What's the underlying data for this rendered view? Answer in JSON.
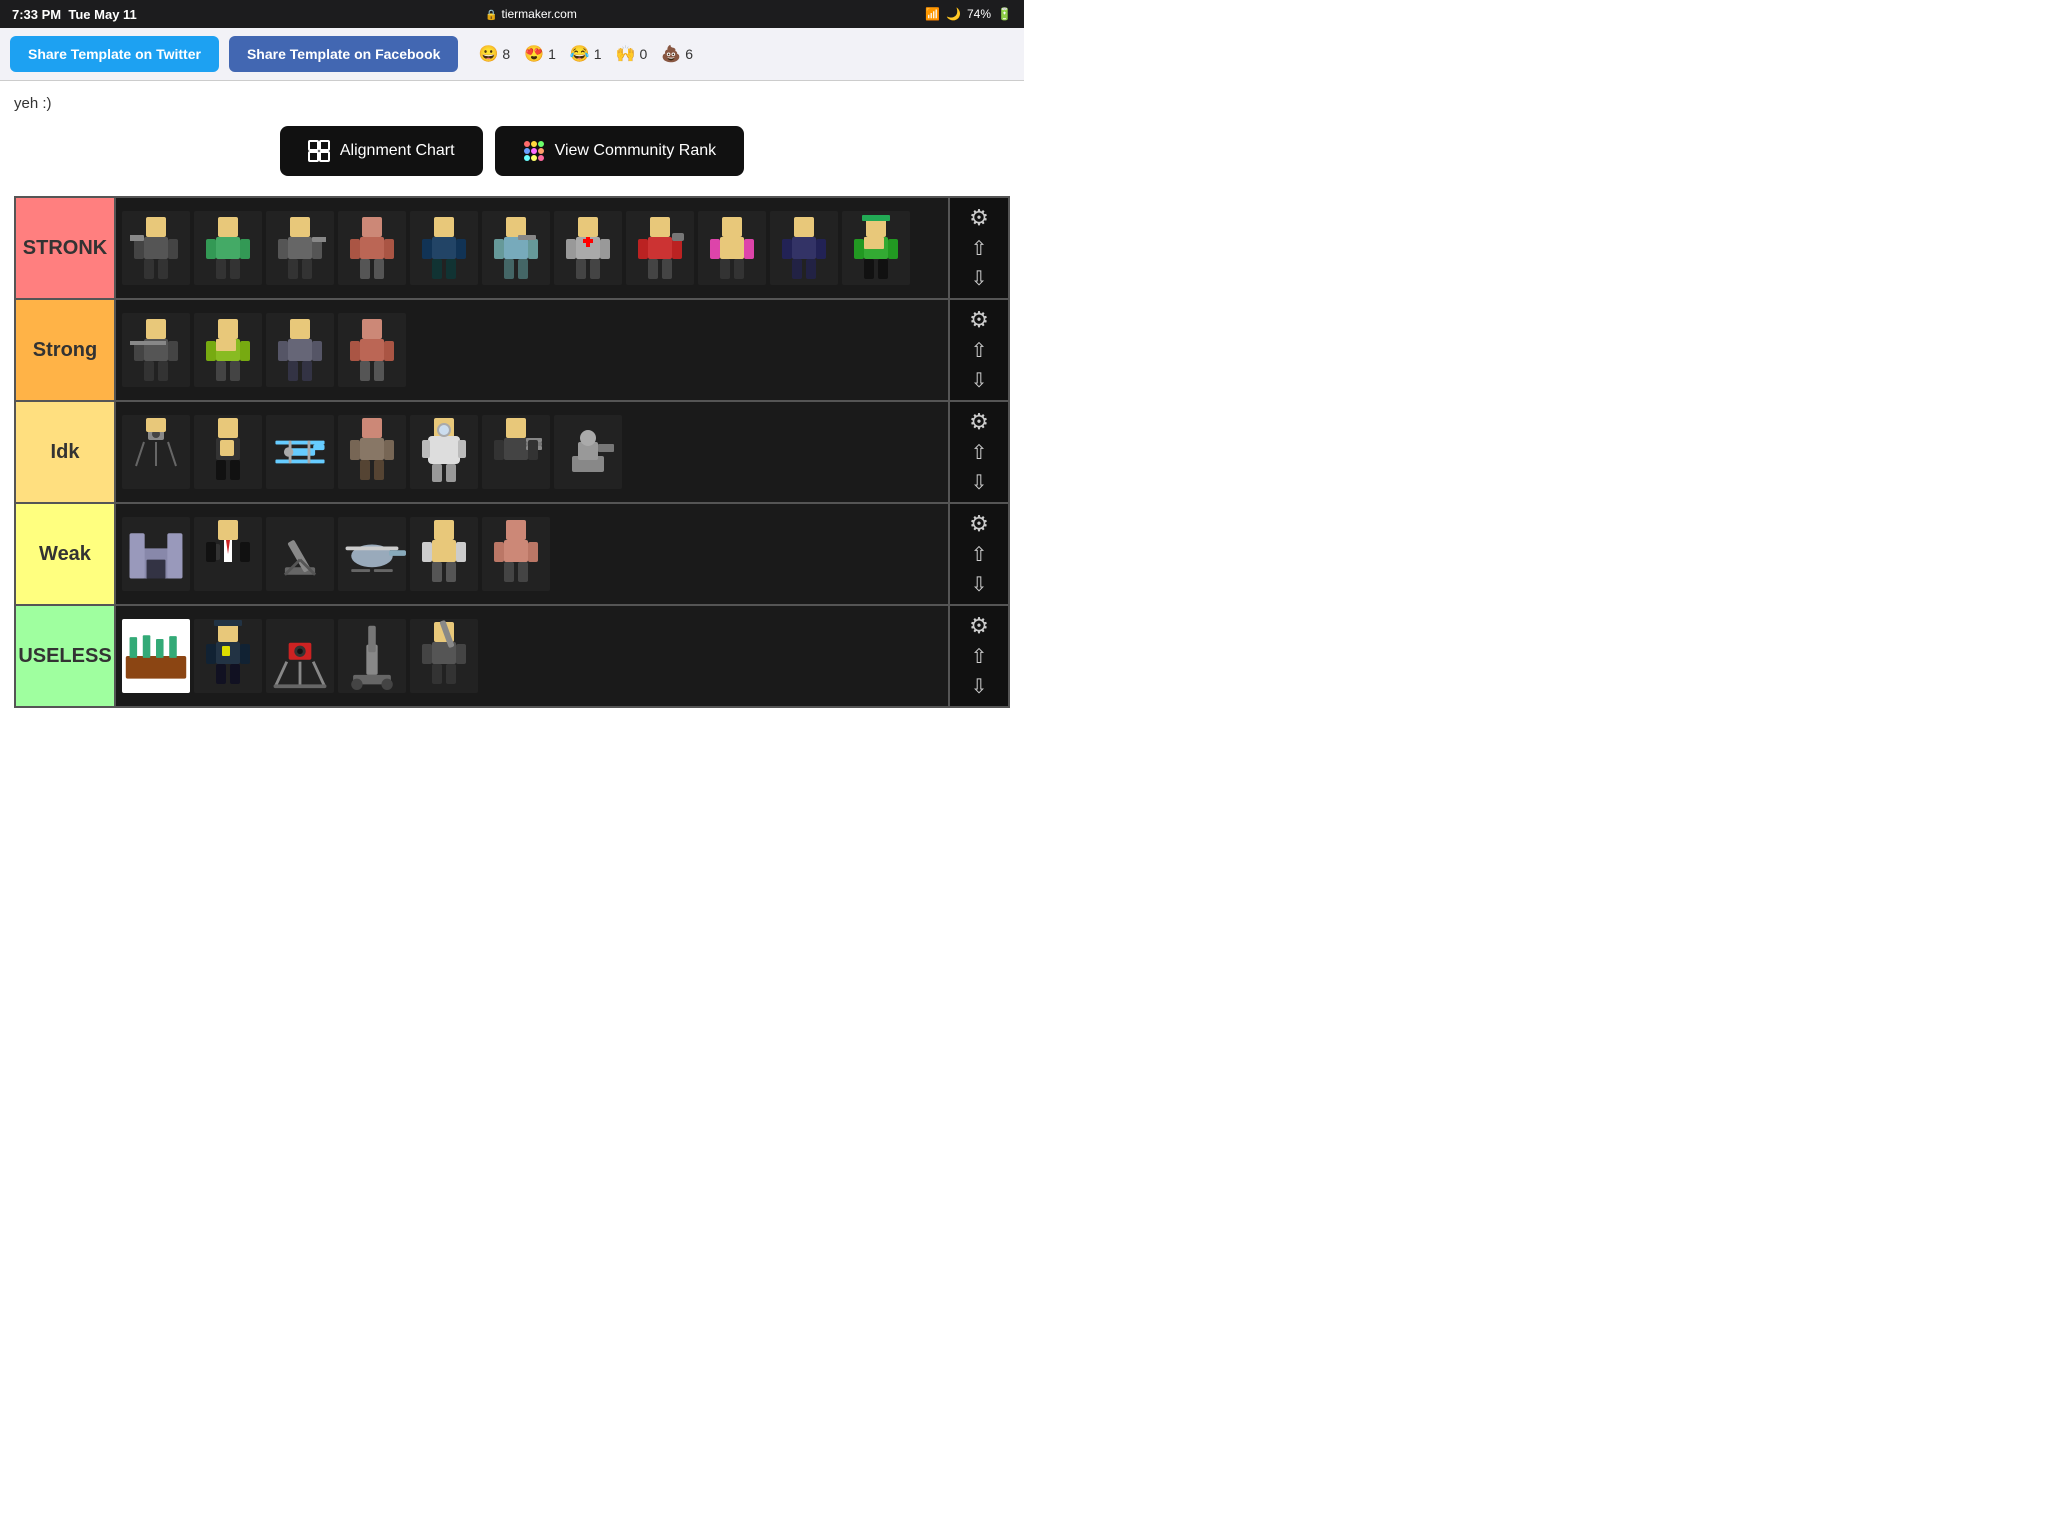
{
  "status_bar": {
    "time": "7:33 PM",
    "date": "Tue May 11",
    "url": "tiermaker.com",
    "battery": "74%"
  },
  "toolbar": {
    "twitter_btn": "Share Template on Twitter",
    "facebook_btn": "Share Template on Facebook",
    "reactions": [
      {
        "emoji": "😀",
        "count": "8"
      },
      {
        "emoji": "😍",
        "count": "1"
      },
      {
        "emoji": "😂",
        "count": "1"
      },
      {
        "emoji": "🙌",
        "count": "0"
      },
      {
        "emoji": "💩",
        "count": "6"
      }
    ]
  },
  "subtitle": "yeh :)",
  "action_buttons": {
    "alignment_chart": "Alignment Chart",
    "community_rank": "View Community Rank"
  },
  "tiers": [
    {
      "id": "stronk",
      "label": "STRONK",
      "color": "#ff7f7f",
      "item_count": 11,
      "items": [
        "🤖",
        "🤖",
        "🤖",
        "🤖",
        "🤖",
        "🤖",
        "🤖",
        "🤖",
        "🤖",
        "🤖",
        "🤖"
      ]
    },
    {
      "id": "strong",
      "label": "Strong",
      "color": "#ffb347",
      "item_count": 4,
      "items": [
        "🤖",
        "🤖",
        "🤖",
        "🤖"
      ]
    },
    {
      "id": "idk",
      "label": "Idk",
      "color": "#ffdf7f",
      "item_count": 7,
      "items": [
        "🤖",
        "🤖",
        "🤖",
        "🤖",
        "🤖",
        "🤖",
        "🤖"
      ]
    },
    {
      "id": "weak",
      "label": "Weak",
      "color": "#ffff7f",
      "item_count": 6,
      "items": [
        "🤖",
        "🤖",
        "🤖",
        "🤖",
        "🤖",
        "🤖"
      ]
    },
    {
      "id": "useless",
      "label": "USELESS",
      "color": "#9fff9f",
      "item_count": 5,
      "items": [
        "🤖",
        "🤖",
        "🤖",
        "🤖",
        "🤖"
      ]
    }
  ]
}
